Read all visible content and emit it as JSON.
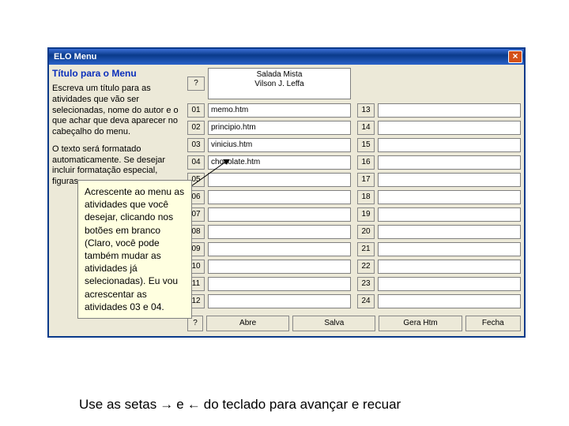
{
  "window": {
    "title": "ELO Menu",
    "close": "×"
  },
  "left_panel": {
    "heading": "Título para o Menu",
    "p1": "Escreva um título para as atividades que vão ser selecionadas, nome do autor e o que achar que deva aparecer no cabeçalho do menu.",
    "p2": "O texto será formatado automaticamente. Se desejar incluir formatação especial, figuras"
  },
  "title_text": "Salada Mista\nVilson J. Leffa",
  "col1": {
    "nums": [
      "?",
      "01",
      "02",
      "03",
      "04",
      "05",
      "06",
      "07",
      "08",
      "09",
      "10",
      "11",
      "12"
    ],
    "vals": [
      "",
      "memo.htm",
      "principio.htm",
      "vinicius.htm",
      "chocolate.htm",
      "",
      "",
      "",
      "",
      "",
      "",
      "",
      ""
    ]
  },
  "col2": {
    "nums": [
      "",
      "13",
      "14",
      "15",
      "16",
      "17",
      "18",
      "19",
      "20",
      "21",
      "22",
      "23",
      "24"
    ],
    "vals": [
      "",
      "",
      "",
      "",
      "",
      "",
      "",
      "",
      "",
      "",
      "",
      "",
      ""
    ]
  },
  "bottom": {
    "q": "?",
    "abre": "Abre",
    "salva": "Salva",
    "gera": "Gera Htm",
    "fecha": "Fecha"
  },
  "tooltip": "Acrescente ao menu as atividades que você desejar, clicando nos botões em branco (Claro, você pode também mudar as atividades já selecionadas).  Eu vou acrescentar as atividades 03 e 04.",
  "caption": {
    "p1": "Use as setas",
    "p2": "e",
    "p3": "do teclado para avançar e recuar",
    "arrow_r": "→",
    "arrow_l": "←"
  }
}
